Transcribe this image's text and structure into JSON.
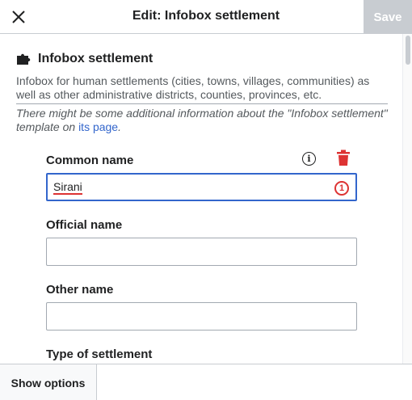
{
  "header": {
    "title": "Edit: Infobox settlement",
    "save_label": "Save"
  },
  "template": {
    "name": "Infobox settlement",
    "description": "Infobox for human settlements (cities, towns, villages, communities) as well as other administrative districts, counties, provinces, etc.",
    "note_prefix": "There might be some additional information about the \"Infobox settlement\" template on ",
    "note_link": "its page",
    "note_suffix": "."
  },
  "fields": [
    {
      "label": "Common name",
      "value": "Sirani",
      "badge": "1"
    },
    {
      "label": "Official name",
      "value": ""
    },
    {
      "label": "Other name",
      "value": ""
    },
    {
      "label": "Type of settlement"
    }
  ],
  "footer": {
    "show_options_label": "Show options"
  },
  "colors": {
    "accent": "#3366cc",
    "error": "#dd3333",
    "save_disabled_bg": "#c8ccd1"
  },
  "icons": [
    "close-icon",
    "puzzle-icon",
    "info-icon",
    "trash-icon"
  ]
}
